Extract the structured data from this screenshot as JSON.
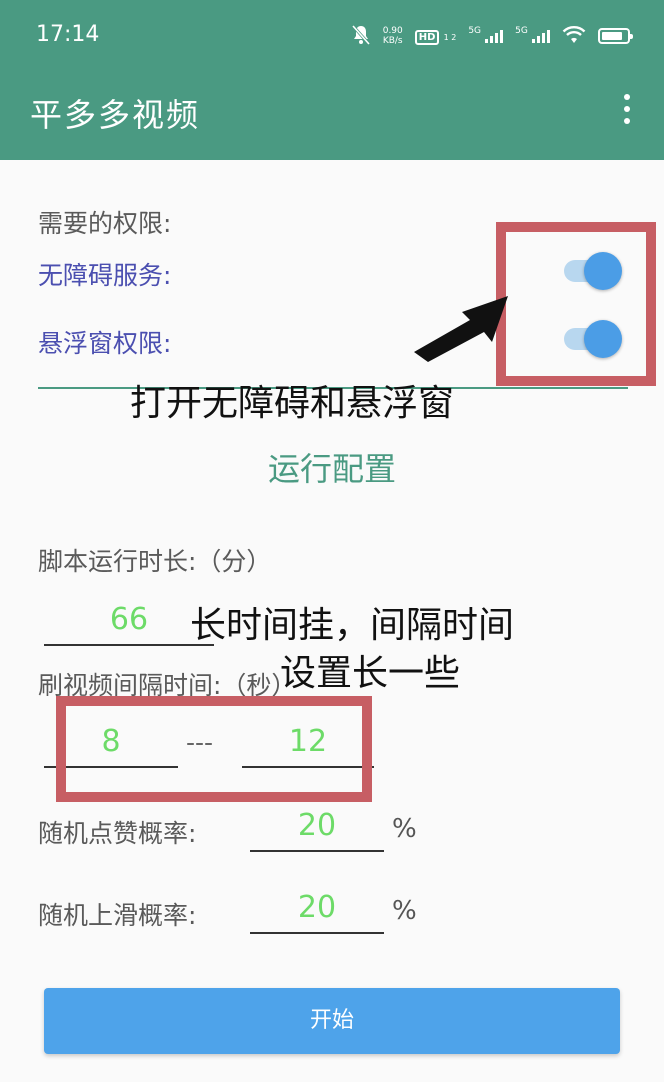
{
  "status_bar": {
    "time": "17:14",
    "net_speed_value": "0.90",
    "net_speed_unit": "KB/s",
    "hd_label": "HD",
    "hd_sub": "1 2",
    "sim1_label": "5G",
    "sim2_label": "5G",
    "icons": [
      "mute-icon",
      "hd-icon",
      "signal-icon",
      "signal-icon",
      "wifi-icon",
      "battery-icon"
    ]
  },
  "app_bar": {
    "title": "平多多视频",
    "menu_icon": "more-vert-icon"
  },
  "permissions": {
    "heading": "需要的权限:",
    "items": [
      {
        "label": "无障碍服务:",
        "enabled": true
      },
      {
        "label": "悬浮窗权限:",
        "enabled": true
      }
    ]
  },
  "annotations": {
    "permissions_hint": "打开无障碍和悬浮窗",
    "interval_hint_line1": "长时间挂，间隔时间",
    "interval_hint_line2": "设置长一些"
  },
  "config": {
    "section_title": "运行配置",
    "runtime_label": "脚本运行时长:（分）",
    "runtime_value": "66",
    "interval_label": "刷视频间隔时间:（秒）",
    "interval_min": "8",
    "interval_separator": "---",
    "interval_max": "12",
    "like_label": "随机点赞概率:",
    "like_value": "20",
    "like_unit": "%",
    "swipe_label": "随机上滑概率:",
    "swipe_value": "20",
    "swipe_unit": "%"
  },
  "start_button": {
    "label": "开始"
  },
  "colors": {
    "app_bar": "#4a9a82",
    "permission_text": "#4b4fb0",
    "value_text": "#6ddb68",
    "switch_knob": "#4b9de6",
    "highlight_box": "#c75e64",
    "start_button": "#4ea3ea"
  }
}
